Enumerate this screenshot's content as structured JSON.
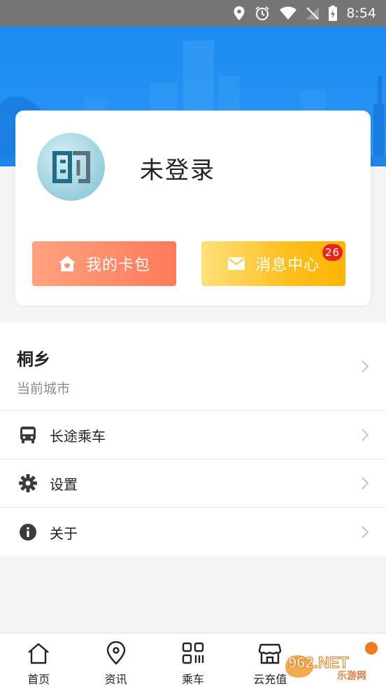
{
  "status_bar": {
    "time": "8:54"
  },
  "profile": {
    "name": "未登录"
  },
  "buttons": {
    "wallet_label": "我的卡包",
    "messages_label": "消息中心",
    "messages_badge": "26"
  },
  "city": {
    "name": "桐乡",
    "subtitle": "当前城市"
  },
  "menu": [
    {
      "label": "长途乘车",
      "icon": "bus-icon"
    },
    {
      "label": "设置",
      "icon": "gear-icon"
    },
    {
      "label": "关于",
      "icon": "info-icon"
    }
  ],
  "tabs": [
    {
      "label": "首页",
      "icon": "home-icon"
    },
    {
      "label": "资讯",
      "icon": "location-pin-icon"
    },
    {
      "label": "乘车",
      "icon": "qr-code-icon"
    },
    {
      "label": "云充值",
      "icon": "store-icon"
    },
    {
      "label": "",
      "icon": "profile-icon"
    }
  ],
  "watermark": {
    "text": "962.NET",
    "sub": "乐游网"
  },
  "colors": {
    "hero_blue": "#1d8bf0",
    "wallet_button": "#ff7a5a",
    "messages_button": "#ffbf1e",
    "badge_red": "#e5261f"
  }
}
